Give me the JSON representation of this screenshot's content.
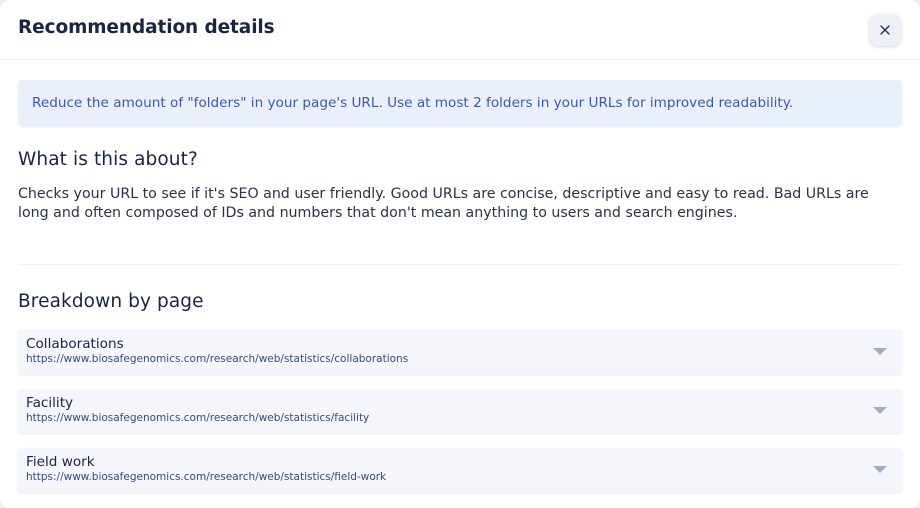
{
  "modal": {
    "title": "Recommendation details",
    "close_icon": "close-icon"
  },
  "banner": {
    "text": "Reduce the amount of \"folders\" in your page's URL. Use at most 2 folders in your URLs for improved readability."
  },
  "about": {
    "title": "What is this about?",
    "body": "Checks your URL to see if it's SEO and user friendly. Good URLs are concise, descriptive and easy to read. Bad URLs are long and often composed of IDs and numbers that don't mean anything to users and search engines."
  },
  "breakdown": {
    "title": "Breakdown by page",
    "pages": [
      {
        "name": "Collaborations",
        "url": "https://www.biosafegenomics.com/research/web/statistics/collaborations"
      },
      {
        "name": "Facility",
        "url": "https://www.biosafegenomics.com/research/web/statistics/facility"
      },
      {
        "name": "Field work",
        "url": "https://www.biosafegenomics.com/research/web/statistics/field-work"
      }
    ]
  },
  "colors": {
    "title": "#1b2440",
    "banner_bg": "#eaf0fb",
    "banner_text": "#3e5aa6",
    "row_bg": "#f4f6fb",
    "caret": "#a4aac0"
  }
}
